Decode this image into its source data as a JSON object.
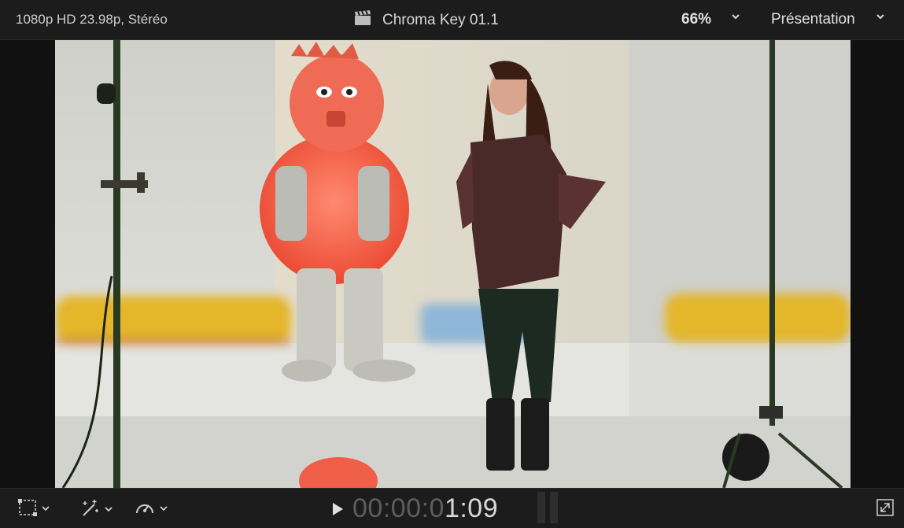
{
  "header": {
    "format": "1080p HD 23.98p, Stéréo",
    "clip_icon": "clapperboard-icon",
    "title": "Chroma Key 01.1",
    "zoom": "66%",
    "view_menu": "Présentation"
  },
  "footer": {
    "transform_tool_icon": "transform-tool-icon",
    "enhance_tool_icon": "magic-wand-icon",
    "retime_tool_icon": "speedometer-icon",
    "play_icon": "play-icon",
    "timecode_dim": "00:00:0",
    "timecode_lit": "1:09",
    "fullscreen_icon": "fullscreen-icon"
  },
  "colors": {
    "bar_background": "#1c1c1c",
    "viewer_border": "#111111"
  }
}
